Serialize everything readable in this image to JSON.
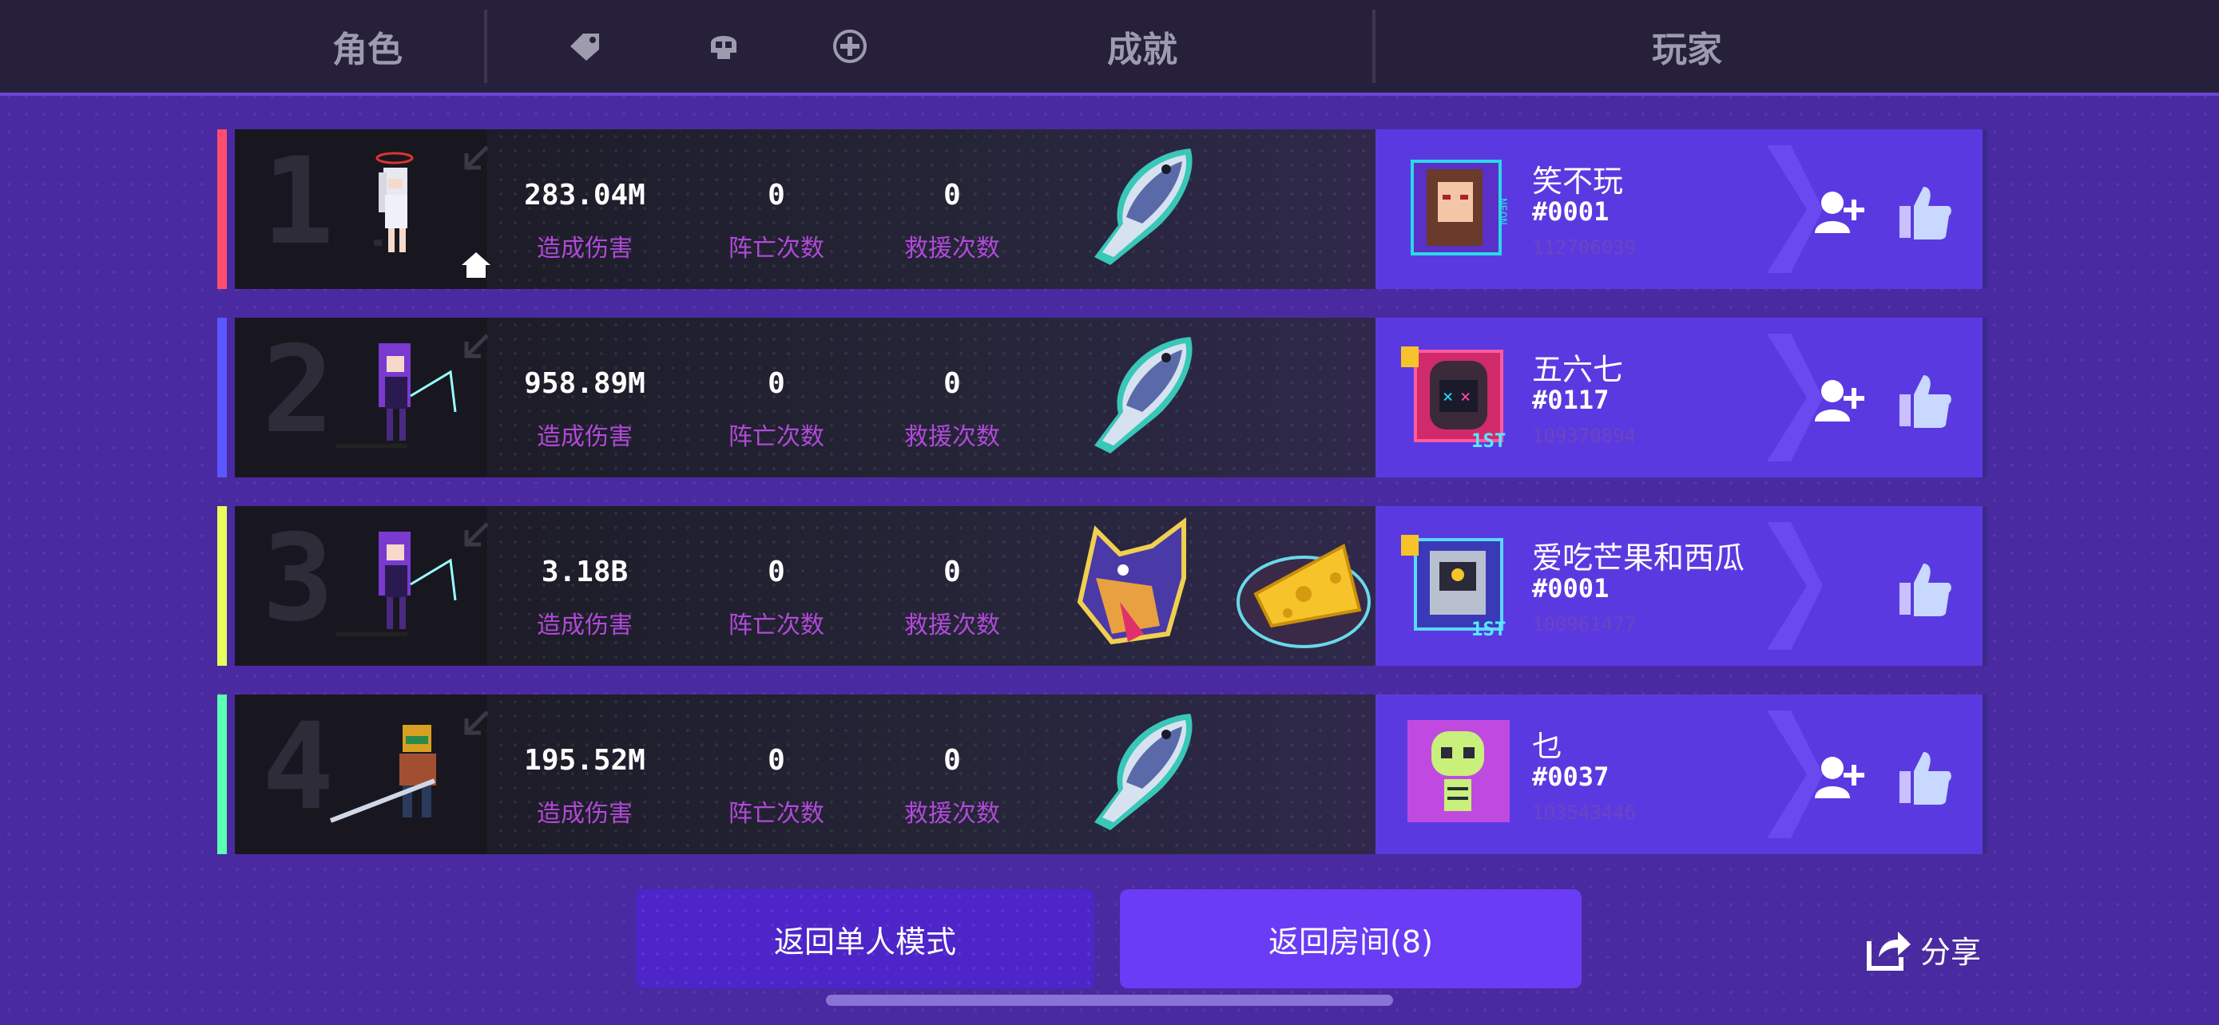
{
  "header": {
    "col_character": "角色",
    "col_achievement": "成就",
    "col_player": "玩家",
    "icons": [
      "tag-icon",
      "skull-icon",
      "plus-circle-icon"
    ]
  },
  "stat_labels": {
    "damage": "造成伤害",
    "deaths": "阵亡次数",
    "rescues": "救援次数"
  },
  "rows": [
    {
      "rank": "1",
      "stripe_color": "#ff4d6d",
      "damage": "283.04M",
      "deaths": "0",
      "rescues": "0",
      "achievements": [
        "fish-icon"
      ],
      "is_host": true,
      "player": {
        "name": "笑不玩",
        "tag": "#0001",
        "id": "112706039",
        "add_friend": true
      }
    },
    {
      "rank": "2",
      "stripe_color": "#5a58ff",
      "damage": "958.89M",
      "deaths": "0",
      "rescues": "0",
      "achievements": [
        "fish-icon"
      ],
      "is_host": false,
      "player": {
        "name": "五六七",
        "tag": "#0117",
        "id": "109370894",
        "add_friend": true
      }
    },
    {
      "rank": "3",
      "stripe_color": "#e6ff5a",
      "damage": "3.18B",
      "deaths": "0",
      "rescues": "0",
      "achievements": [
        "werewolf-icon",
        "cheese-icon"
      ],
      "is_host": false,
      "player": {
        "name": "爱吃芒果和西瓜",
        "tag": "#0001",
        "id": "100961477",
        "add_friend": false
      }
    },
    {
      "rank": "4",
      "stripe_color": "#5affb0",
      "damage": "195.52M",
      "deaths": "0",
      "rescues": "0",
      "achievements": [
        "fish-icon"
      ],
      "is_host": false,
      "player": {
        "name": "乜",
        "tag": "#0037",
        "id": "103543446",
        "add_friend": true
      }
    }
  ],
  "buttons": {
    "return_single": "返回单人模式",
    "return_room": "返回房间(8)",
    "share": "分享"
  }
}
